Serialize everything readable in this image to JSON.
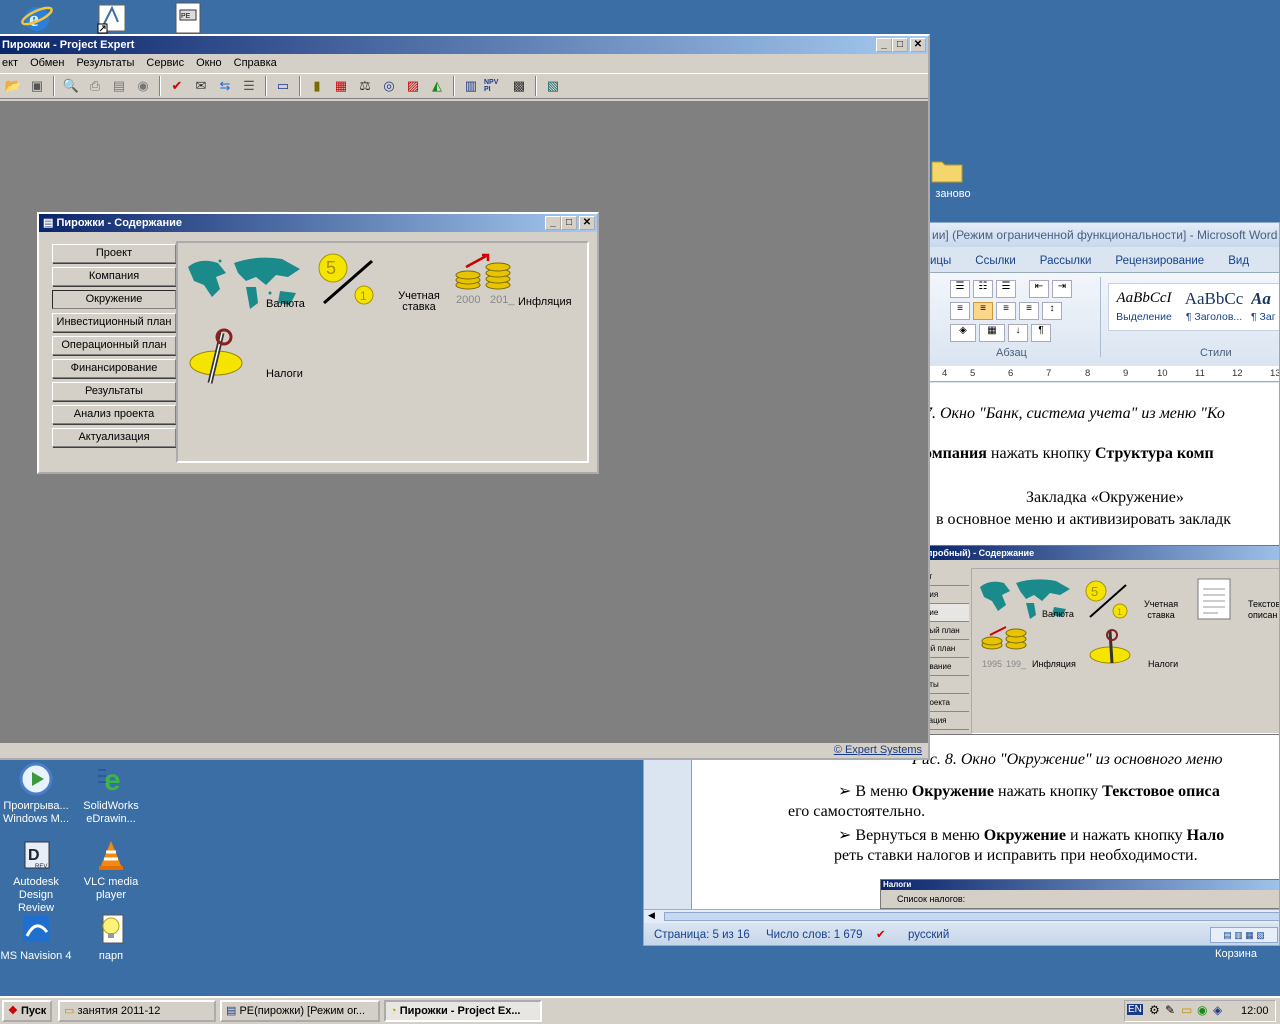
{
  "desktop": {
    "icons_top": [
      {
        "name": "ie-icon"
      },
      {
        "name": "shortcut-icon"
      },
      {
        "name": "document-icon"
      }
    ],
    "icons": [
      {
        "label": "Проигрыва...\nWindows M...",
        "icon": "media-player-icon"
      },
      {
        "label": "SolidWorks\neDrawin...",
        "icon": "edrawings-icon"
      },
      {
        "label": "Autodesk\nDesign Review",
        "icon": "design-review-icon"
      },
      {
        "label": "VLC media\nplayer",
        "icon": "vlc-icon"
      },
      {
        "label": "MS Navision 4",
        "icon": "navision-icon"
      },
      {
        "label": "парп",
        "icon": "bulb-file-icon"
      },
      {
        "label": "заново",
        "icon": "folder-icon"
      },
      {
        "label": "Корзина",
        "icon": "recycle-bin-icon"
      }
    ]
  },
  "pe_window": {
    "title": "Пирожки - Project Expert",
    "menu": [
      "ект",
      "Обмен",
      "Результаты",
      "Сервис",
      "Окно",
      "Справка"
    ],
    "statusbar": "© Expert Systems",
    "buttons": {
      "min": "_",
      "max": "□",
      "close": "✕"
    }
  },
  "content_window": {
    "title": "Пирожки - Содержание",
    "nav": [
      "Проект",
      "Компания",
      "Окружение",
      "Инвестиционный план",
      "Операционный план",
      "Финансирование",
      "Результаты",
      "Анализ проекта",
      "Актуализация"
    ],
    "active_nav": "Окружение",
    "tiles": {
      "currency": "Валюта",
      "discount": "Учетная\nставка",
      "inflation": "Инфляция",
      "years": [
        "2000",
        "201_"
      ],
      "taxes": "Налоги"
    }
  },
  "word_window": {
    "title": "ии] (Режим ограниченной функциональности] - Microsoft Word",
    "tabs": [
      "ицы",
      "Ссылки",
      "Рассылки",
      "Рецензирование",
      "Вид"
    ],
    "styles": [
      {
        "sample": "AaBbCcI",
        "name": "Выделение"
      },
      {
        "sample": "AaBbCc",
        "name": "¶ Заголов..."
      },
      {
        "sample": "Aa",
        "name": "¶ Заг"
      }
    ],
    "group_paragraph": "Абзац",
    "group_styles": "Стили",
    "ruler": [
      "4",
      "5",
      "6",
      "7",
      "8",
      "9",
      "10",
      "11",
      "12",
      "13"
    ],
    "doc": {
      "caption1": "7. Окно \"Банк, система учета\" из меню \"Ко",
      "line2_bold": "омпания",
      "line2_rest": " нажать кнопку ",
      "line2_bold2": "Структура комп",
      "line3": "Закладка «Окружение»",
      "line4": "в основное меню и активизировать закладк",
      "embedded_title": "пробный) - Содержание",
      "embedded_nav": [
        "кт",
        "ния",
        "ние",
        "ный план",
        "ый план",
        "ование",
        "аты",
        "роекта",
        "зация"
      ],
      "embedded_labels": {
        "currency": "Валюта",
        "discount": "Учетная\nставка",
        "text": "Текстов\nописан",
        "inflation": "Инфляция",
        "taxes": "Налоги",
        "years": [
          "1995",
          "199_"
        ]
      },
      "caption2": "Рис. 8. Окно \"Окружение\" из основного меню",
      "bullet1_a": "В меню ",
      "bullet1_b": "Окружение",
      "bullet1_c": " нажать кнопку ",
      "bullet1_d": "Текстовое описа",
      "line_self": "его самостоятельно.",
      "bullet2_a": "Вернуться в меню ",
      "bullet2_b": "Окружение",
      "bullet2_c": " и нажать кнопку ",
      "bullet2_d": "Нало",
      "line_rates": "реть ставки налогов и исправить при необходимости.",
      "taxes_bar": "Налоги",
      "taxes_list": "Список налогов:"
    },
    "status": {
      "page": "Страница: 5 из 16",
      "words": "Число слов: 1 679",
      "lang": "русский"
    }
  },
  "taskbar": {
    "start": "Пуск",
    "items": [
      "занятия 2011-12",
      "PE(пирожки) [Режим ог...",
      "Пирожки - Project Ex..."
    ],
    "lang": "EN",
    "clock": "12:00"
  }
}
